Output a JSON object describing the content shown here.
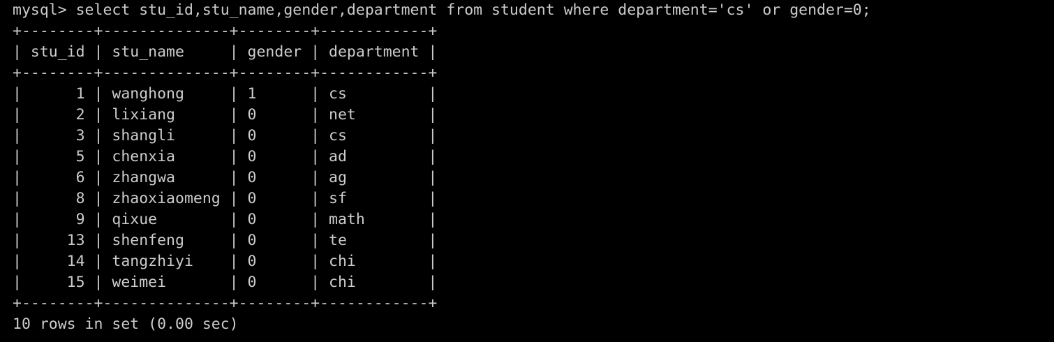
{
  "terminal": {
    "lines": [
      "mysql> select stu_id,stu_name,gender,department from student where department='cs' or gender=0;",
      "+--------+--------------+--------+------------+",
      "| stu_id | stu_name     | gender | department |",
      "+--------+--------------+--------+------------+",
      "|      1 | wanghong     | 1      | cs         |",
      "|      2 | lixiang      | 0      | net        |",
      "|      3 | shangli      | 0      | cs         |",
      "|      5 | chenxia      | 0      | ad         |",
      "|      6 | zhangwa      | 0      | ag         |",
      "|      8 | zhaoxiaomeng | 0      | sf         |",
      "|      9 | qixue        | 0      | math       |",
      "|     13 | shenfeng     | 0      | te         |",
      "|     14 | tangzhiyi    | 0      | chi        |",
      "|     15 | weimei       | 0      | chi        |",
      "+--------+--------------+--------+------------+",
      "10 rows in set (0.00 sec)"
    ]
  },
  "colors": {
    "background": "#000000",
    "text": "#cccccc"
  }
}
